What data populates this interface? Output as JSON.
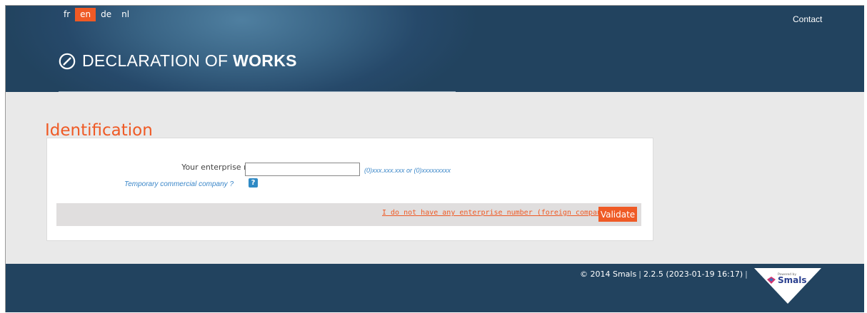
{
  "header": {
    "languages": [
      {
        "code": "fr",
        "active": false
      },
      {
        "code": "en",
        "active": true
      },
      {
        "code": "de",
        "active": false
      },
      {
        "code": "nl",
        "active": false
      }
    ],
    "contact_label": "Contact",
    "logo": {
      "icon": "compass-icon",
      "text_regular": "DECLARATION OF ",
      "text_bold": "WORKS"
    }
  },
  "main": {
    "title": "Identification",
    "form": {
      "enterprise_label": "Your enterprise number",
      "enterprise_value": "",
      "enterprise_placeholder": "",
      "format_hint": "(0)xxx.xxx.xxx or (0)xxxxxxxxx",
      "temp_company_link": "Temporary commercial company ?",
      "help_label": "?",
      "no_number_link": "I do not have any enterprise number (foreign company)",
      "validate_label": "Validate"
    }
  },
  "footer": {
    "copyright": "© 2014 Smals",
    "version": "2.2.5 (2023-01-19 16:17)",
    "badge_powered": "Powered by",
    "badge_brand": "Smals"
  },
  "colors": {
    "accent": "#ef5a25",
    "header_bg": "#22435f",
    "link": "#3a86c8",
    "page_bg": "#e9e9e9"
  }
}
